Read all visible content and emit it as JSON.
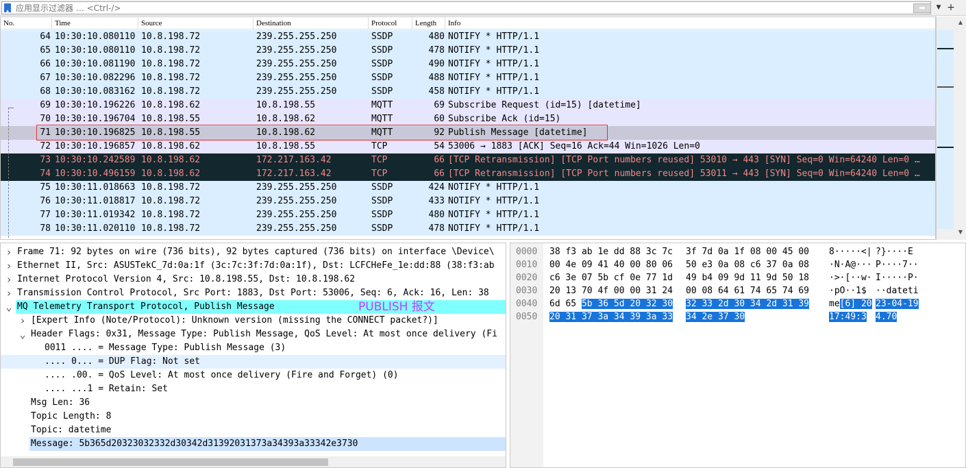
{
  "filter": {
    "placeholder": "应用显示过滤器 … <Ctrl-/>",
    "apply_icon": "arrow-right-icon",
    "add_label": "+"
  },
  "packet_list": {
    "columns": [
      "No.",
      "Time",
      "Source",
      "Destination",
      "Protocol",
      "Length",
      "Info"
    ],
    "rows": [
      {
        "no": "64",
        "time": "10:30:10.080110",
        "src": "10.8.198.72",
        "dst": "239.255.255.250",
        "proto": "SSDP",
        "len": "480",
        "info": "NOTIFY * HTTP/1.1",
        "style": "ssdp"
      },
      {
        "no": "65",
        "time": "10:30:10.080110",
        "src": "10.8.198.72",
        "dst": "239.255.255.250",
        "proto": "SSDP",
        "len": "478",
        "info": "NOTIFY * HTTP/1.1",
        "style": "ssdp"
      },
      {
        "no": "66",
        "time": "10:30:10.081190",
        "src": "10.8.198.72",
        "dst": "239.255.255.250",
        "proto": "SSDP",
        "len": "490",
        "info": "NOTIFY * HTTP/1.1",
        "style": "ssdp"
      },
      {
        "no": "67",
        "time": "10:30:10.082296",
        "src": "10.8.198.72",
        "dst": "239.255.255.250",
        "proto": "SSDP",
        "len": "488",
        "info": "NOTIFY * HTTP/1.1",
        "style": "ssdp"
      },
      {
        "no": "68",
        "time": "10:30:10.083162",
        "src": "10.8.198.72",
        "dst": "239.255.255.250",
        "proto": "SSDP",
        "len": "458",
        "info": "NOTIFY * HTTP/1.1",
        "style": "ssdp"
      },
      {
        "no": "69",
        "time": "10:30:10.196226",
        "src": "10.8.198.62",
        "dst": "10.8.198.55",
        "proto": "MQTT",
        "len": "69",
        "info": "Subscribe Request (id=15) [datetime]",
        "style": "mqtt"
      },
      {
        "no": "70",
        "time": "10:30:10.196704",
        "src": "10.8.198.55",
        "dst": "10.8.198.62",
        "proto": "MQTT",
        "len": "60",
        "info": "Subscribe Ack (id=15)",
        "style": "mqtt"
      },
      {
        "no": "71",
        "time": "10:30:10.196825",
        "src": "10.8.198.55",
        "dst": "10.8.198.62",
        "proto": "MQTT",
        "len": "92",
        "info": "Publish Message [datetime]",
        "style": "sel"
      },
      {
        "no": "72",
        "time": "10:30:10.196857",
        "src": "10.8.198.62",
        "dst": "10.8.198.55",
        "proto": "TCP",
        "len": "54",
        "info": "53006 → 1883 [ACK] Seq=16 Ack=44 Win=1026 Len=0",
        "style": "mqtt"
      },
      {
        "no": "73",
        "time": "10:30:10.242589",
        "src": "10.8.198.62",
        "dst": "172.217.163.42",
        "proto": "TCP",
        "len": "66",
        "info": "[TCP Retransmission] [TCP Port numbers reused] 53010 → 443 [SYN] Seq=0 Win=64240 Len=0 …",
        "style": "bad"
      },
      {
        "no": "74",
        "time": "10:30:10.496159",
        "src": "10.8.198.62",
        "dst": "172.217.163.42",
        "proto": "TCP",
        "len": "66",
        "info": "[TCP Retransmission] [TCP Port numbers reused] 53011 → 443 [SYN] Seq=0 Win=64240 Len=0 …",
        "style": "bad"
      },
      {
        "no": "75",
        "time": "10:30:11.018663",
        "src": "10.8.198.72",
        "dst": "239.255.255.250",
        "proto": "SSDP",
        "len": "424",
        "info": "NOTIFY * HTTP/1.1",
        "style": "ssdp"
      },
      {
        "no": "76",
        "time": "10:30:11.018817",
        "src": "10.8.198.72",
        "dst": "239.255.255.250",
        "proto": "SSDP",
        "len": "433",
        "info": "NOTIFY * HTTP/1.1",
        "style": "ssdp"
      },
      {
        "no": "77",
        "time": "10:30:11.019342",
        "src": "10.8.198.72",
        "dst": "239.255.255.250",
        "proto": "SSDP",
        "len": "480",
        "info": "NOTIFY * HTTP/1.1",
        "style": "ssdp"
      },
      {
        "no": "78",
        "time": "10:30:11.020110",
        "src": "10.8.198.72",
        "dst": "239.255.255.250",
        "proto": "SSDP",
        "len": "478",
        "info": "NOTIFY * HTTP/1.1",
        "style": "ssdp"
      }
    ]
  },
  "details": {
    "rows": [
      {
        "arrow": "right",
        "text": "Frame 71: 92 bytes on wire (736 bits), 92 bytes captured (736 bits) on interface \\Device\\",
        "hl": "",
        "indent": 0
      },
      {
        "arrow": "right",
        "text": "Ethernet II, Src: ASUSTekC_7d:0a:1f (3c:7c:3f:7d:0a:1f), Dst: LCFCHeFe_1e:dd:88 (38:f3:ab",
        "hl": "",
        "indent": 0
      },
      {
        "arrow": "right",
        "text": "Internet Protocol Version 4, Src: 10.8.198.55, Dst: 10.8.198.62",
        "hl": "",
        "indent": 0
      },
      {
        "arrow": "right",
        "text": "Transmission Control Protocol, Src Port: 1883, Dst Port: 53006, Seq: 6, Ack: 16, Len: 38",
        "hl": "",
        "indent": 0
      },
      {
        "arrow": "down",
        "text": "MQ Telemetry Transport Protocol, Publish Message",
        "hl": "cyan",
        "indent": 0
      },
      {
        "arrow": "right",
        "text": "[Expert Info (Note/Protocol): Unknown version (missing the CONNECT packet?)]",
        "hl": "",
        "indent": 1
      },
      {
        "arrow": "down",
        "text": "Header Flags: 0x31, Message Type: Publish Message, QoS Level: At most once delivery (Fi",
        "hl": "",
        "indent": 1
      },
      {
        "arrow": "",
        "text": "0011 .... = Message Type: Publish Message (3)",
        "hl": "",
        "indent": 2
      },
      {
        "arrow": "",
        "text": ".... 0... = DUP Flag: Not set",
        "hl": "blue",
        "indent": 2
      },
      {
        "arrow": "",
        "text": ".... .00. = QoS Level: At most once delivery (Fire and Forget) (0)",
        "hl": "",
        "indent": 2
      },
      {
        "arrow": "",
        "text": ".... ...1 = Retain: Set",
        "hl": "",
        "indent": 2
      },
      {
        "arrow": "",
        "text": "Msg Len: 36",
        "hl": "",
        "indent": 1
      },
      {
        "arrow": "",
        "text": "Topic Length: 8",
        "hl": "",
        "indent": 1
      },
      {
        "arrow": "",
        "text": "Topic: datetime",
        "hl": "",
        "indent": 1
      },
      {
        "arrow": "",
        "text": "Message: 5b365d20323032332d30342d31392031373a34393a33342e3730",
        "hl": "msg",
        "indent": 1
      }
    ],
    "annotation": "PUBLISH 报文"
  },
  "bytes": {
    "rows": [
      {
        "off": "0000",
        "hex1": "38 f3 ab 1e dd 88 3c 7c",
        "hex1_hl": "",
        "hex2": "3f 7d 0a 1f 08 00 45 00",
        "hex2_hl": "",
        "asc1": "8·····<|",
        "asc1_hl": "",
        "asc2": " ?}····E",
        "asc2_hl": ""
      },
      {
        "off": "0010",
        "hex1": "00 4e 09 41 40 00 80 06",
        "hex1_hl": "",
        "hex2": "50 e3 0a 08 c6 37 0a 08",
        "hex2_hl": "",
        "asc1": "·N·A@···",
        "asc1_hl": "",
        "asc2": "P····7··",
        "asc2_hl": ""
      },
      {
        "off": "0020",
        "hex1": "c6 3e 07 5b cf 0e 77 1d",
        "hex1_hl": "",
        "hex2": "49 b4 09 9d 11 9d 50 18",
        "hex2_hl": "",
        "asc1": "·>·[··w·",
        "asc1_hl": "",
        "asc2": "I·····P·",
        "asc2_hl": ""
      },
      {
        "off": "0030",
        "hex1": "20 13 70 4f 00 00 31 24",
        "hex1_hl": "",
        "hex2": "00 08 64 61 74 65 74 69",
        "hex2_hl": "",
        "asc1": " ·pO··1$",
        "asc1_hl": "",
        "asc2": "··dateti",
        "asc2_hl": ""
      },
      {
        "off": "0040",
        "hex1": "6d 65 ",
        "hex1_hl": "5b 36 5d 20 32 30",
        "hex2": "",
        "hex2_hl": "32 33 2d 30 34 2d 31 39",
        "asc1": "me",
        "asc1_hl": "[6] 20",
        "asc2": "",
        "asc2_hl": "23-04-19"
      },
      {
        "off": "0050",
        "hex1": "",
        "hex1_hl": "20 31 37 3a 34 39 3a 33",
        "hex2": "",
        "hex2_hl": "34 2e 37 30",
        "asc1": "",
        "asc1_hl": " 17:49:3",
        "asc2": "",
        "asc2_hl": "4.70"
      }
    ]
  }
}
